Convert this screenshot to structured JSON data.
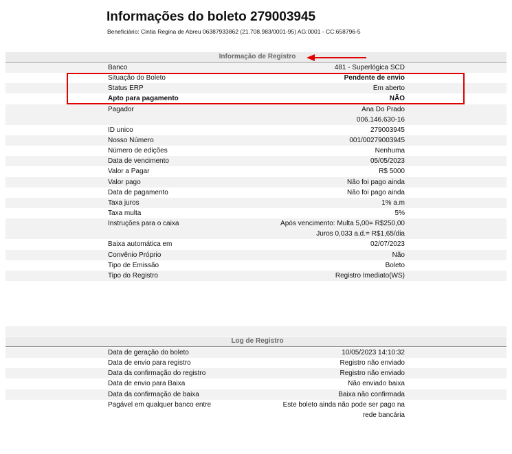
{
  "header": {
    "title": "Informações do boleto 279003945",
    "beneficiary": "Beneficiário: Cintia Regina de Abreu 06387933862  (21.708.983/0001-95) AG:0001 - CC:658796-5"
  },
  "registro": {
    "section_title": "Informação de Registro",
    "rows": [
      {
        "label": "Banco",
        "value": "481 - Superlógica SCD",
        "bold": false
      },
      {
        "label": "Situação do Boleto",
        "value": "Pendente de envio",
        "bold": false,
        "value_bold": true
      },
      {
        "label": "Status ERP",
        "value": "Em aberto",
        "bold": false
      },
      {
        "label": "Apto para pagamento",
        "value": "NÃO",
        "bold": true
      },
      {
        "label": "Pagador",
        "value": "Ana Do Prado",
        "bold": false
      },
      {
        "label": "",
        "value": "006.146.630-16",
        "bold": false,
        "continuation": true
      },
      {
        "label": "ID unico",
        "value": "279003945",
        "bold": false
      },
      {
        "label": "Nosso Número",
        "value": "001/00279003945",
        "bold": false
      },
      {
        "label": "Número de edições",
        "value": "Nenhuma",
        "bold": false
      },
      {
        "label": "Data de vencimento",
        "value": "05/05/2023",
        "bold": false
      },
      {
        "label": "Valor a Pagar",
        "value": "R$ 5000",
        "bold": false
      },
      {
        "label": "Valor pago",
        "value": "Não foi pago ainda",
        "bold": false
      },
      {
        "label": "Data de pagamento",
        "value": "Não foi pago ainda",
        "bold": false
      },
      {
        "label": "Taxa juros",
        "value": "1% a.m",
        "bold": false
      },
      {
        "label": "Taxa multa",
        "value": "5%",
        "bold": false
      },
      {
        "label": "Instruções para o caixa",
        "value": "Após vencimento: Multa 5,00= R$250,00",
        "bold": false
      },
      {
        "label": "",
        "value": "Juros 0,033 a.d.= R$1,65/dia",
        "bold": false,
        "continuation": true
      },
      {
        "label": "Baixa automática em",
        "value": "02/07/2023",
        "bold": false
      },
      {
        "label": "Convênio Próprio",
        "value": "Não",
        "bold": false
      },
      {
        "label": "Tipo de Emissão",
        "value": "Boleto",
        "bold": false
      },
      {
        "label": "Tipo do Registro",
        "value": "Registro Imediato(WS)",
        "bold": false
      }
    ]
  },
  "log": {
    "section_title": "Log de Registro",
    "rows": [
      {
        "label": "Data de geração do boleto",
        "value": "10/05/2023 14:10:32"
      },
      {
        "label": "Data de envio para registro",
        "value": "Registro não enviado"
      },
      {
        "label": "Data da confirmação do registro",
        "value": "Registro não enviado"
      },
      {
        "label": "Data de envio para Baixa",
        "value": "Não enviado baixa"
      },
      {
        "label": "Data da confirmação de baixa",
        "value": "Baixa não confirmada"
      },
      {
        "label": "Pagável em qualquer banco entre",
        "value": "Este boleto ainda não pode ser pago na"
      },
      {
        "label": "",
        "value": "rede bancária",
        "continuation": true
      }
    ]
  },
  "annotation_colors": {
    "highlight": "#e00000",
    "arrow": "#e00000"
  }
}
